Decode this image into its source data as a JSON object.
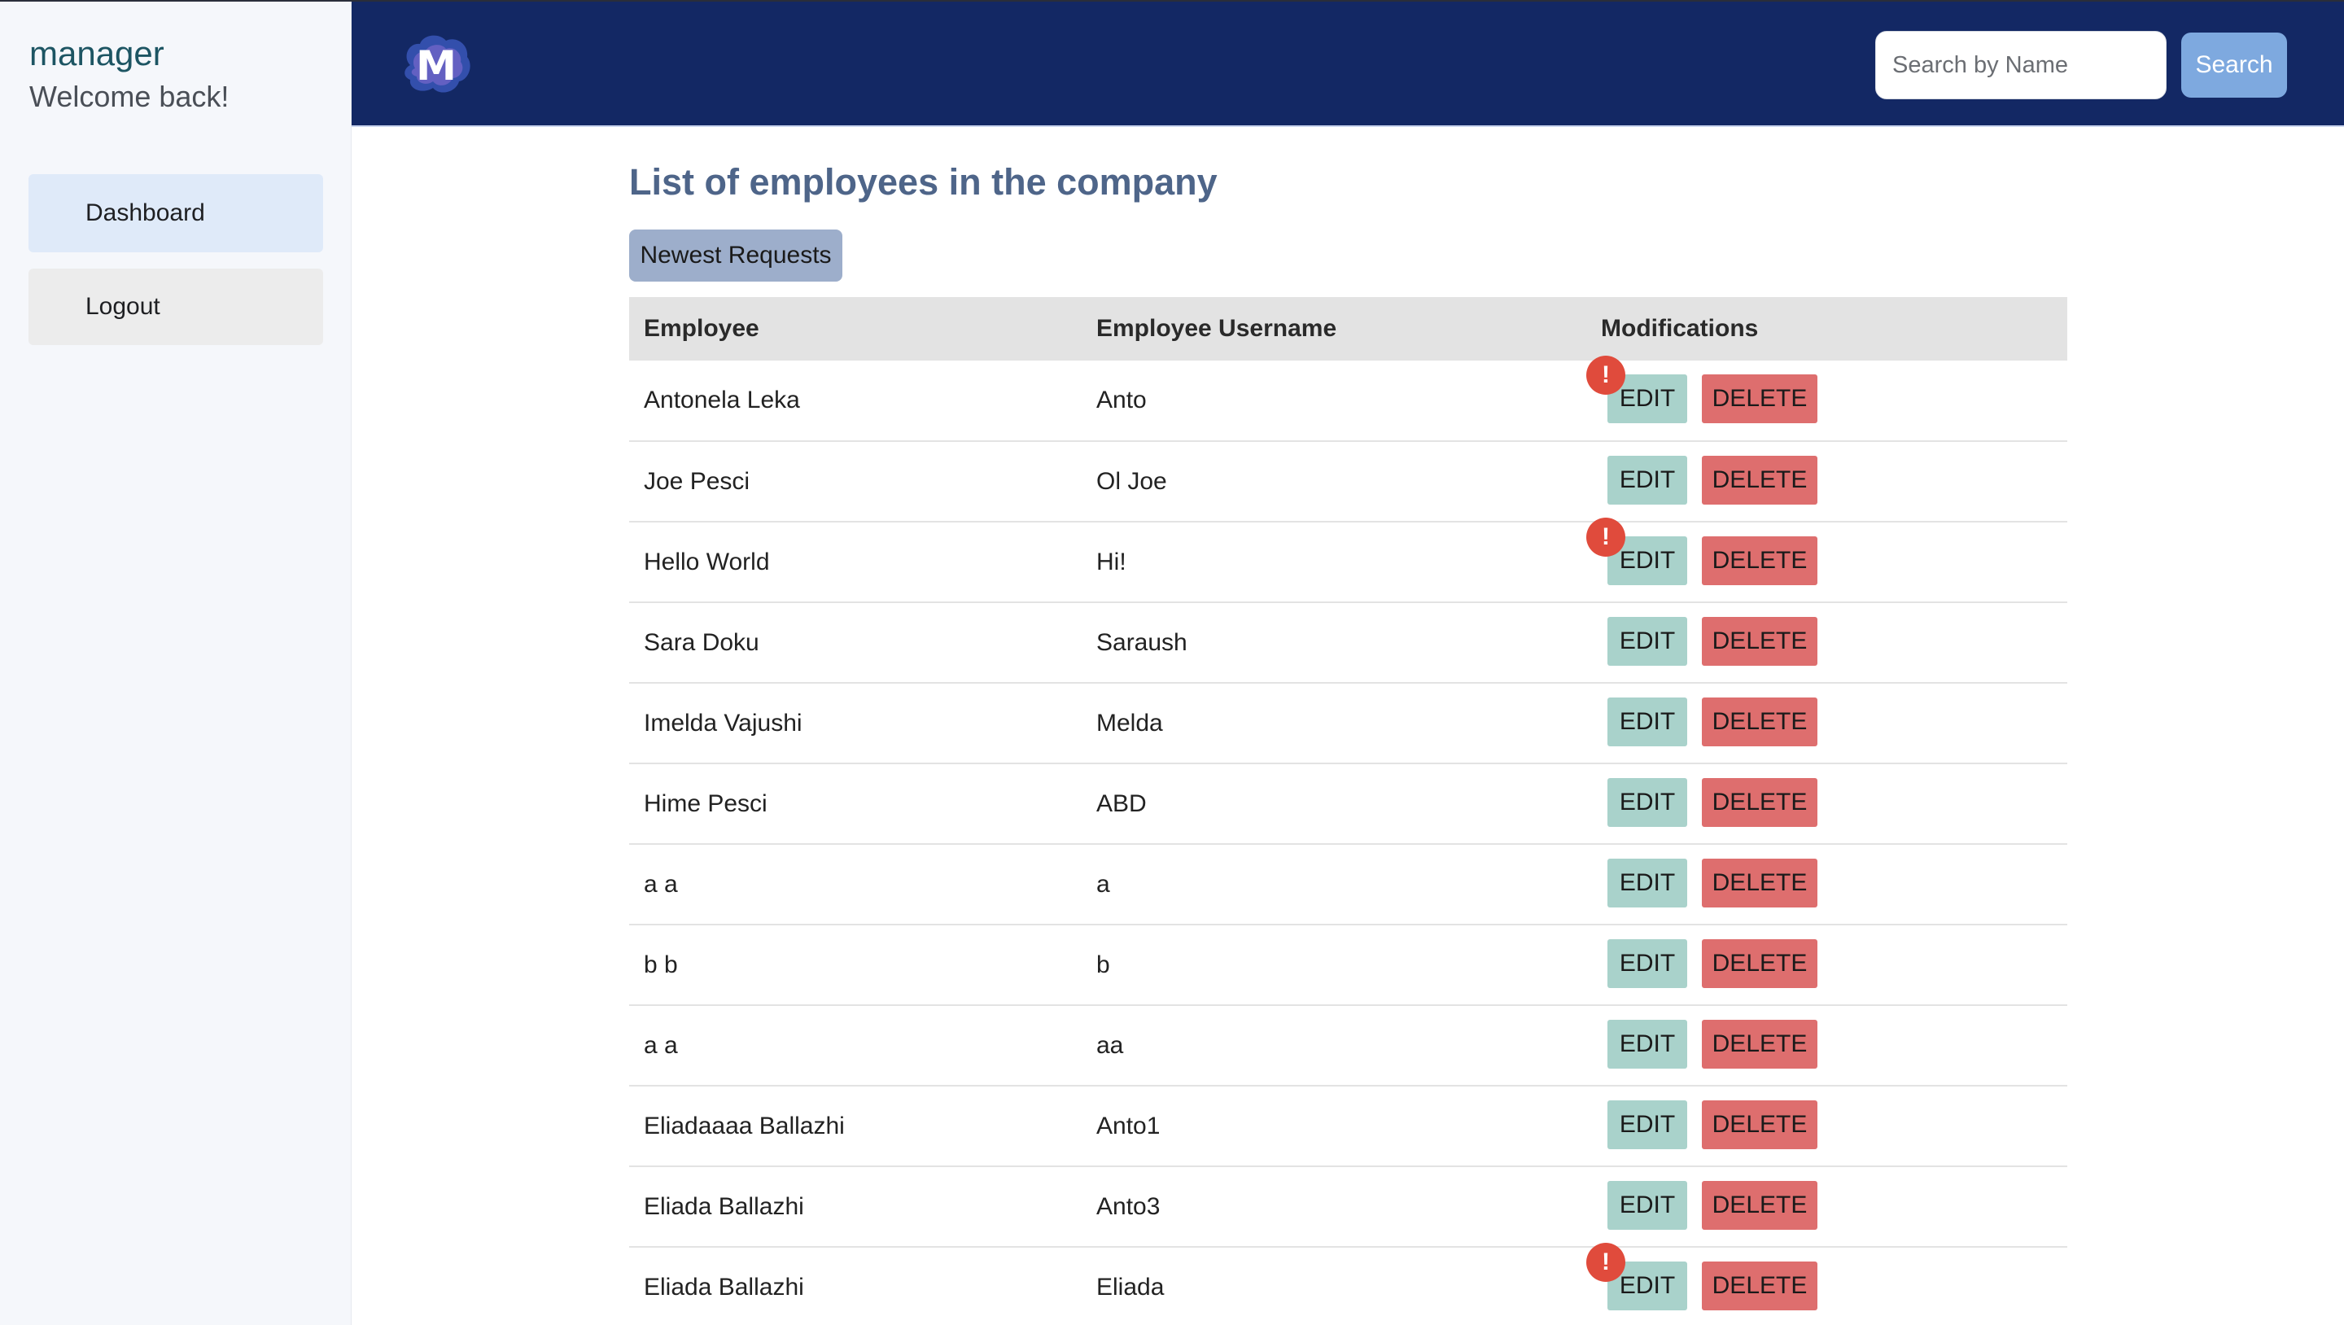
{
  "sidebar": {
    "user_name": "manager",
    "welcome": "Welcome back!",
    "items": [
      {
        "label": "Dashboard",
        "active": true
      },
      {
        "label": "Logout",
        "active": false
      }
    ]
  },
  "header": {
    "logo_letter": "M",
    "search_placeholder": "Search by Name",
    "search_value": "",
    "search_button": "Search"
  },
  "main": {
    "title": "List of employees in the company",
    "newest_requests_label": "Newest Requests",
    "table": {
      "headers": [
        "Employee",
        "Employee Username",
        "Modifications"
      ],
      "edit_label": "EDIT",
      "delete_label": "DELETE",
      "alert_symbol": "!",
      "rows": [
        {
          "employee": "Antonela Leka",
          "username": "Anto",
          "alert": true
        },
        {
          "employee": "Joe Pesci",
          "username": "Ol Joe",
          "alert": false
        },
        {
          "employee": "Hello World",
          "username": "Hi!",
          "alert": true
        },
        {
          "employee": "Sara Doku",
          "username": "Saraush",
          "alert": false
        },
        {
          "employee": "Imelda Vajushi",
          "username": "Melda",
          "alert": false
        },
        {
          "employee": "Hime Pesci",
          "username": "ABD",
          "alert": false
        },
        {
          "employee": "a a",
          "username": "a",
          "alert": false
        },
        {
          "employee": "b b",
          "username": "b",
          "alert": false
        },
        {
          "employee": "a a",
          "username": "aa",
          "alert": false
        },
        {
          "employee": "Eliadaaaa Ballazhi",
          "username": "Anto1",
          "alert": false
        },
        {
          "employee": "Eliada Ballazhi",
          "username": "Anto3",
          "alert": false
        },
        {
          "employee": "Eliada Ballazhi",
          "username": "Eliada",
          "alert": true
        }
      ]
    }
  },
  "colors": {
    "header_bg": "#132864",
    "sidebar_bg": "#f5f7fb",
    "edit_bg": "#a9d2cb",
    "delete_bg": "#de6e6e",
    "alert_bg": "#e04b3c",
    "title_color": "#4e6589"
  }
}
